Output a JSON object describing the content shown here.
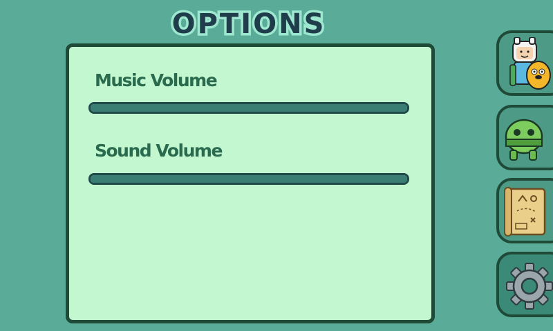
{
  "screen": {
    "title": "OPTIONS"
  },
  "options": {
    "music": {
      "label": "Music Volume",
      "level": 1.0
    },
    "sound": {
      "label": "Sound Volume",
      "level": 1.0
    }
  },
  "tabs": [
    {
      "name": "characters",
      "icon": "finn-and-jake-icon",
      "active": false
    },
    {
      "name": "enemies",
      "icon": "green-creature-icon",
      "active": false
    },
    {
      "name": "map",
      "icon": "treasure-map-icon",
      "active": false
    },
    {
      "name": "options",
      "icon": "gear-icon",
      "active": true
    }
  ],
  "colors": {
    "background": "#5aac98",
    "panel": "#c3f7d0",
    "panel_border": "#1f4a38",
    "label": "#2a6a4e",
    "slider": "#3a7d73",
    "title_fill": "#1f3d4a",
    "title_outline": "#9fe8d0"
  }
}
